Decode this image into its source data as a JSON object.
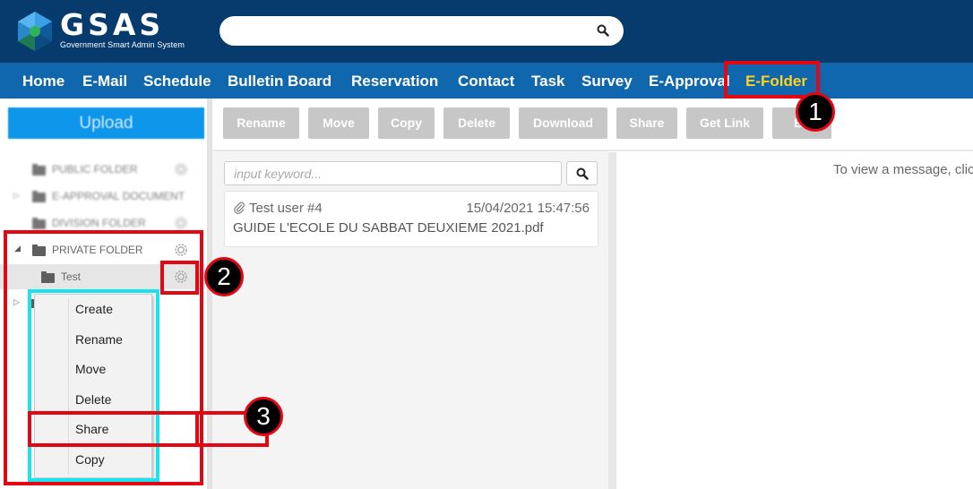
{
  "header": {
    "brand_name": "GSAS",
    "brand_subtitle": "Government Smart Admin System",
    "search_placeholder": ""
  },
  "nav": {
    "items": [
      {
        "label": "Home"
      },
      {
        "label": "E-Mail"
      },
      {
        "label": "Schedule"
      },
      {
        "label": "Bulletin Board"
      },
      {
        "label": "Reservation"
      },
      {
        "label": "Contact"
      },
      {
        "label": "Task"
      },
      {
        "label": "Survey"
      },
      {
        "label": "E-Approval"
      },
      {
        "label": "E-Folder"
      }
    ],
    "active": "E-Folder"
  },
  "sidebar": {
    "upload_label": "Upload",
    "folders": [
      {
        "label": "PUBLIC FOLDER"
      },
      {
        "label": "E-APPROVAL DOCUMENT"
      },
      {
        "label": "DIVISION FOLDER"
      },
      {
        "label": "PRIVATE FOLDER"
      },
      {
        "label": "Test"
      }
    ]
  },
  "context_menu": {
    "items": [
      {
        "label": "Create"
      },
      {
        "label": "Rename"
      },
      {
        "label": "Move"
      },
      {
        "label": "Delete"
      },
      {
        "label": "Share"
      },
      {
        "label": "Copy"
      }
    ]
  },
  "toolbar": {
    "buttons": [
      {
        "label": "Rename"
      },
      {
        "label": "Move"
      },
      {
        "label": "Copy"
      },
      {
        "label": "Delete"
      },
      {
        "label": "Download"
      },
      {
        "label": "Share"
      },
      {
        "label": "Get Link"
      },
      {
        "label": "En"
      }
    ]
  },
  "list": {
    "search_placeholder": "input keyword...",
    "items": [
      {
        "sender": "Test user #4",
        "datetime": "15/04/2021 15:47:56",
        "subject": "GUIDE L'ECOLE DU SABBAT DEUXIEME 2021.pdf"
      }
    ]
  },
  "viewer": {
    "hint": "To view a message, click"
  },
  "annotations": {
    "step1": "1",
    "step2": "2",
    "step3": "3"
  },
  "colors": {
    "header_bg": "#073b6d",
    "nav_bg": "#1167ad",
    "active_nav": "#ffd21f",
    "upload_bg": "#0e96ea",
    "annotation_red": "#e30613",
    "annotation_cyan": "#19e3ef"
  }
}
